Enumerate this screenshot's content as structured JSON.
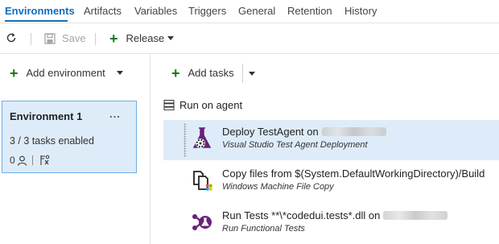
{
  "tabs": [
    {
      "label": "Environments",
      "active": true
    },
    {
      "label": "Artifacts"
    },
    {
      "label": "Variables"
    },
    {
      "label": "Triggers"
    },
    {
      "label": "General"
    },
    {
      "label": "Retention"
    },
    {
      "label": "History"
    }
  ],
  "toolbar": {
    "refresh_icon": "refresh-icon",
    "save_label": "Save",
    "save_enabled": false,
    "release_label": "Release"
  },
  "left": {
    "add_environment_label": "Add environment",
    "environment": {
      "name": "Environment 1",
      "more_label": "...",
      "tasks_status": "3 / 3 tasks enabled",
      "approvers_count": "0"
    }
  },
  "right": {
    "add_tasks_label": "Add tasks",
    "phase_label": "Run on agent",
    "tasks": [
      {
        "name": "Deploy TestAgent on",
        "type": "Visual Studio Test Agent Deployment",
        "icon": "test-agent-deploy-icon",
        "selected": true
      },
      {
        "name": "Copy files from $(System.DefaultWorkingDirectory)/Build",
        "type": "Windows Machine File Copy",
        "icon": "file-copy-icon",
        "selected": false
      },
      {
        "name": "Run Tests **\\*codedui.tests*.dll on",
        "type": "Run Functional Tests",
        "icon": "run-tests-icon",
        "selected": false
      }
    ]
  },
  "colors": {
    "accent": "#106ebe",
    "add_green": "#107c10",
    "selection": "#deecf9",
    "flask_purple": "#68217a"
  }
}
